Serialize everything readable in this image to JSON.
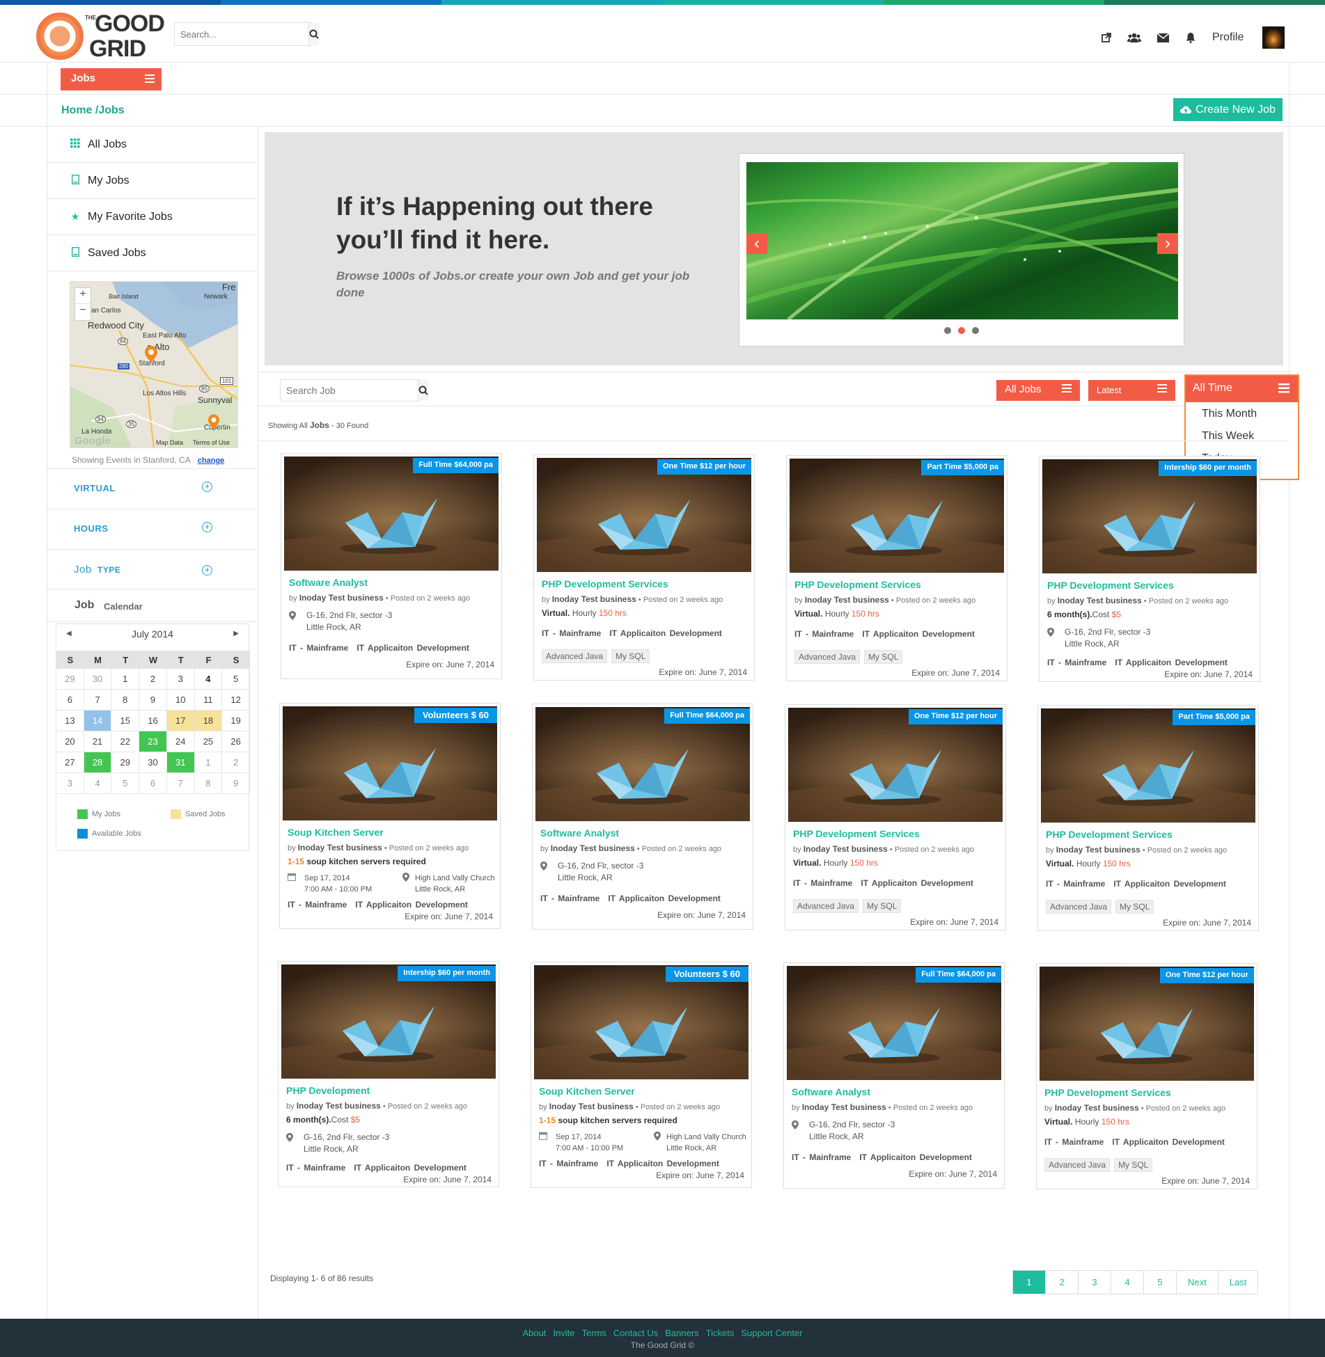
{
  "topbar_colors": [
    "#0b5aa6",
    "#1273c0",
    "#17a5b8",
    "#1ab0a0",
    "#1ea867",
    "#1b7a58"
  ],
  "header": {
    "logo_line1": "GOOD",
    "logo_line2": "GRID",
    "logo_small": "THE",
    "search_placeholder": "Search...",
    "icons": [
      "external-link-icon",
      "users-icon",
      "envelope-icon",
      "bell-icon"
    ],
    "profile_label": "Profile"
  },
  "jobs_menu": {
    "label": "Jobs"
  },
  "breadcrumb": "Home /Jobs",
  "create_button": "Create New Job",
  "sidebar": {
    "items": [
      {
        "label": "All Jobs",
        "icon": "grid-icon"
      },
      {
        "label": "My Jobs",
        "icon": "file-icon"
      },
      {
        "label": "My Favorite Jobs",
        "icon": "star-icon"
      },
      {
        "label": "Saved Jobs",
        "icon": "file-icon"
      }
    ],
    "map": {
      "labels": [
        "Bair Island",
        "Newark",
        "an Carlos",
        "Redwood City",
        "East Palo Alto",
        "o Alto",
        "Stanford",
        "Los Altos Hills",
        "Sunnyval",
        "La Honda",
        "Cupertin",
        "Fre",
        "84",
        "101",
        "280",
        "85",
        "35",
        "84",
        "Google",
        "Map Data",
        "Terms of Use"
      ],
      "zoom_in": "+",
      "zoom_out": "−"
    },
    "map_footer": "Showing Events in Stanford, CA",
    "map_change": "change",
    "filters": [
      "VIRTUAL",
      "HOURS"
    ],
    "job_type": {
      "a": "Job",
      "b": "TYPE"
    },
    "job_calendar": {
      "a": "Job",
      "b": "Calendar"
    },
    "calendar": {
      "month": "July 2014",
      "dow": [
        "S",
        "M",
        "T",
        "W",
        "T",
        "F",
        "S"
      ],
      "days": [
        [
          "29",
          "o"
        ],
        [
          "30",
          "o"
        ],
        [
          "1",
          ""
        ],
        [
          "2",
          ""
        ],
        [
          "3",
          ""
        ],
        [
          "4",
          "b"
        ],
        [
          "5",
          ""
        ],
        [
          "6",
          ""
        ],
        [
          "7",
          ""
        ],
        [
          "8",
          ""
        ],
        [
          "9",
          ""
        ],
        [
          "10",
          ""
        ],
        [
          "11",
          ""
        ],
        [
          "12",
          ""
        ],
        [
          "13",
          ""
        ],
        [
          "14",
          "blue"
        ],
        [
          "15",
          ""
        ],
        [
          "16",
          ""
        ],
        [
          "17",
          "yel"
        ],
        [
          "18",
          "yel"
        ],
        [
          "19",
          ""
        ],
        [
          "20",
          ""
        ],
        [
          "21",
          ""
        ],
        [
          "22",
          ""
        ],
        [
          "23",
          "grn"
        ],
        [
          "24",
          ""
        ],
        [
          "25",
          ""
        ],
        [
          "26",
          ""
        ],
        [
          "27",
          ""
        ],
        [
          "28",
          "grn"
        ],
        [
          "29",
          ""
        ],
        [
          "30",
          ""
        ],
        [
          "31",
          "grn"
        ],
        [
          "1",
          "o"
        ],
        [
          "2",
          "o"
        ],
        [
          "3",
          "o"
        ],
        [
          "4",
          "o"
        ],
        [
          "5",
          "o"
        ],
        [
          "6",
          "o"
        ],
        [
          "7",
          "o"
        ],
        [
          "8",
          "o"
        ],
        [
          "9",
          "o"
        ]
      ],
      "legend": [
        {
          "label": "My Jobs",
          "color": "#43c651"
        },
        {
          "label": "Saved Jobs",
          "color": "#f7e29a"
        },
        {
          "label": "Available Jobs",
          "color": "#0e8ed6"
        }
      ]
    }
  },
  "banner": {
    "title_line1": "If it’s Happening out there",
    "title_line2": "you’ll find it here.",
    "subtitle": "Browse 1000s of Jobs.or create your own Job and get your job done",
    "slides": 3,
    "active_slide": 2
  },
  "toolbar": {
    "search_placeholder": "Search Job",
    "filter1": "All Jobs",
    "filter2": "Latest",
    "time_selected": "All Time",
    "time_options": [
      "This Month",
      "This Week",
      "Today"
    ]
  },
  "showing": {
    "pre": "Showing All",
    "mid": "Jobs",
    "post": "- 30 Found"
  },
  "common": {
    "by_pre": "by",
    "company": "Inoday Test business",
    "posted": "• Posted on 2 weeks ago",
    "address1": "G-16, 2nd Flr, sector -3",
    "address2": "Little Rock, AR",
    "cat1": "IT - Mainframe",
    "cat2": "IT Applicaiton Development",
    "tag1": "Advanced Java",
    "tag2": "My SQL",
    "expire": "Expire on: June 7, 2014",
    "virtual": "Virtual.",
    "hourly": "Hourly",
    "hrs": "150 hrs",
    "months": "6 month(s).",
    "cost": "Cost",
    "cost_val": "$5",
    "range": "1-15",
    "servers": "soup kitchen servers required",
    "ev_date": "Sep 17, 2014",
    "ev_time": "7:00 AM - 10:00 PM",
    "ev_place1": "High Land Vally Church",
    "ev_place2": "Little Rock, AR"
  },
  "cards": [
    {
      "badge": "Full Time $64,000 pa",
      "title": "Software Analyst",
      "kind": "addr"
    },
    {
      "badge": "One Time $12 per hour",
      "title": "PHP Development Services",
      "kind": "virt"
    },
    {
      "badge": "Part Time $5,000 pa",
      "title": "PHP Development Services",
      "kind": "virt"
    },
    {
      "badge": "Intership $60 per month",
      "title": "PHP Development Services",
      "kind": "month"
    },
    {
      "badge": "Volunteers  $ 60",
      "title": "Soup Kitchen Server",
      "kind": "event"
    },
    {
      "badge": "Full Time $64,000 pa",
      "title": "Software Analyst",
      "kind": "addr"
    },
    {
      "badge": "One Time $12 per hour",
      "title": "PHP Development Services",
      "kind": "virt"
    },
    {
      "badge": "Part Time $5,000 pa",
      "title": "PHP Development Services",
      "kind": "virt"
    },
    {
      "badge": "Intership $60 per month",
      "title": "PHP Development",
      "kind": "month"
    },
    {
      "badge": "Volunteers  $ 60",
      "title": "Soup Kitchen Server",
      "kind": "event"
    },
    {
      "badge": "Full Time $64,000 pa",
      "title": "Software Analyst",
      "kind": "addr"
    },
    {
      "badge": "One Time $12 per hour",
      "title": "PHP Development Services",
      "kind": "virt"
    }
  ],
  "displaying": "Displaying 1- 6 of 86 results",
  "pagination": [
    "1",
    "2",
    "3",
    "4",
    "5",
    "Next",
    "Last"
  ],
  "footer": {
    "links": [
      "About",
      "Invite",
      "Terms",
      "Contact Us",
      "Banners",
      "Tickets",
      "Support Center"
    ],
    "copyright": "The Good Grid ©"
  }
}
